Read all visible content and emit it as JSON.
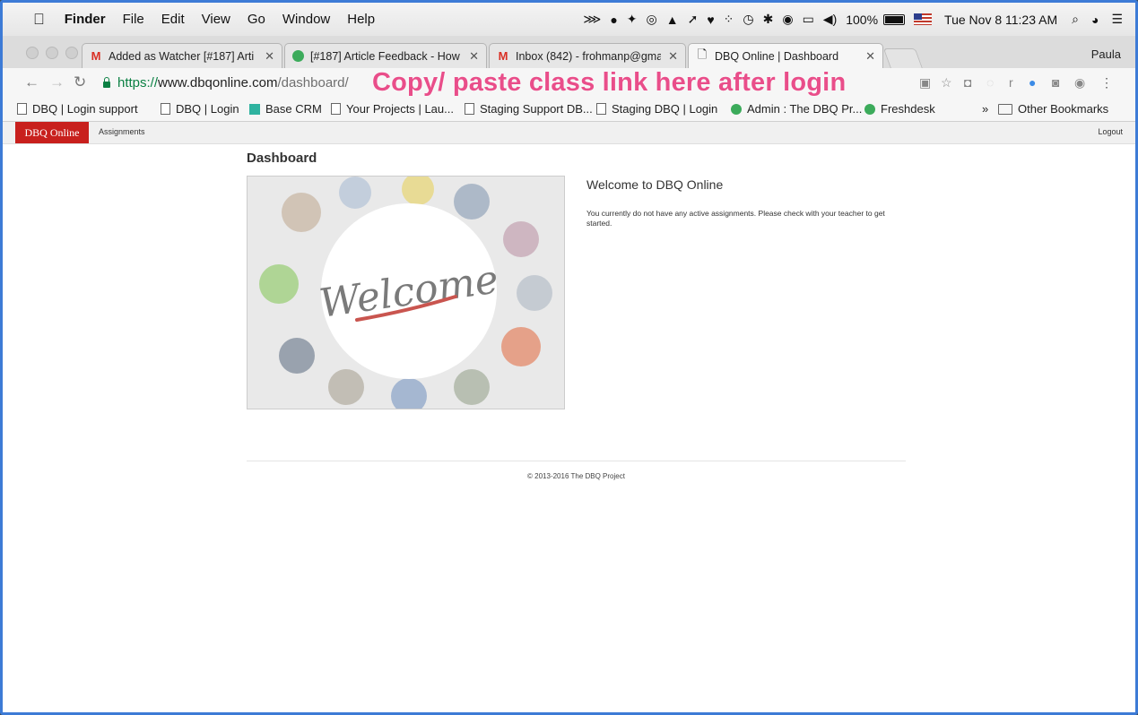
{
  "menubar": {
    "app_name": "Finder",
    "items": [
      "File",
      "Edit",
      "View",
      "Go",
      "Window",
      "Help"
    ],
    "battery": "100%",
    "datetime": "Tue Nov 8  11:23 AM"
  },
  "browser": {
    "tabs": [
      {
        "title": "Added as Watcher [#187] Arti",
        "favicon": "gmail-icon"
      },
      {
        "title": "[#187] Article Feedback - How",
        "favicon": "freshdesk-icon"
      },
      {
        "title": "Inbox (842) - frohmanp@gmai",
        "favicon": "gmail-icon"
      },
      {
        "title": "DBQ Online | Dashboard",
        "favicon": "page-icon"
      }
    ],
    "profile_name": "Paula",
    "url_scheme": "https://",
    "url_host": "www.dbqonline.com",
    "url_path": "/dashboard/",
    "annotation": "Copy/ paste class link here after login",
    "bookmarks": [
      "DBQ | Login support",
      "DBQ | Login",
      "Base CRM",
      "Your Projects | Lau...",
      "Staging Support DB...",
      "Staging DBQ | Login",
      "Admin : The DBQ Pr...",
      "Freshdesk"
    ],
    "other_bookmarks": "Other Bookmarks",
    "overflow": "»"
  },
  "site": {
    "brand": "DBQ Online",
    "nav_assignments": "Assignments",
    "logout": "Logout",
    "page_title": "Dashboard",
    "welcome_heading": "Welcome to DBQ Online",
    "welcome_body": "You currently do not have any active assignments. Please check with your teacher to get started.",
    "image_text": "Welcome",
    "footer": "© 2013-2016 The DBQ Project"
  },
  "colors": {
    "brand_red": "#c8201d",
    "annotation_pink": "#e94e8a",
    "window_border": "#3d7bd6"
  }
}
